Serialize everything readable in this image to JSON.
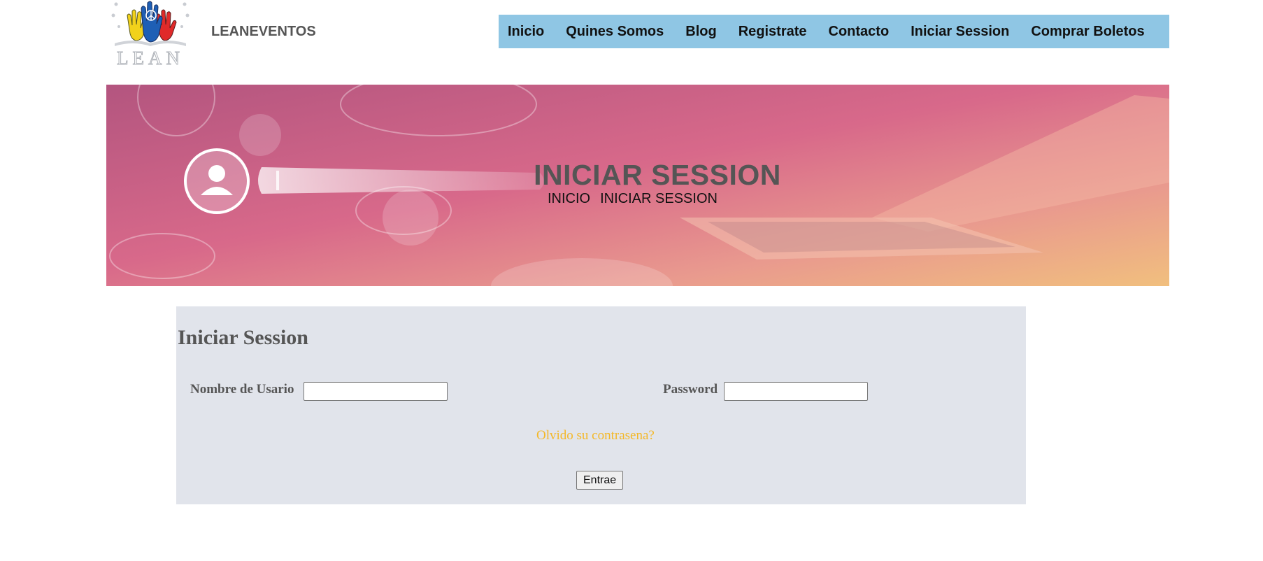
{
  "header": {
    "logo_text": "LEAN",
    "site_name": "LEANEVENTOS"
  },
  "nav": {
    "items": [
      {
        "label": "Inicio"
      },
      {
        "label": "Quines Somos"
      },
      {
        "label": "Blog"
      },
      {
        "label": "Registrate"
      },
      {
        "label": "Contacto"
      },
      {
        "label": "Iniciar Session"
      },
      {
        "label": "Comprar Boletos"
      }
    ]
  },
  "banner": {
    "title": "INICIAR SESSION",
    "breadcrumb": [
      "INICIO",
      "INICIAR SESSION"
    ]
  },
  "login": {
    "title": "Iniciar Session",
    "username_label": "Nombre de Usario",
    "username_value": "",
    "password_label": "Password",
    "password_value": "",
    "forgot_link": "Olvido su contrasena?",
    "submit_label": "Entrae"
  },
  "colors": {
    "nav_background": "#8fc6e4",
    "panel_background": "#e1e4eb",
    "link": "#f4b828",
    "heading": "#555555"
  },
  "icons": [
    "logo-hands-icon",
    "user-search-icon",
    "laptop-icon"
  ]
}
